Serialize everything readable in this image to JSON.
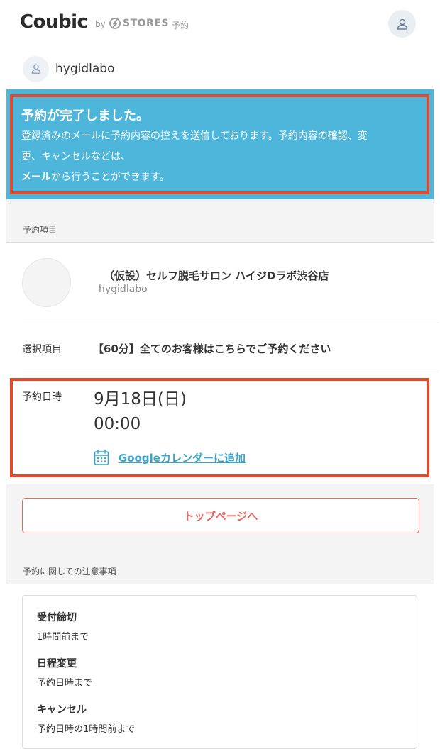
{
  "header": {
    "logo": "Coubic",
    "by": "by",
    "stores": "STORES",
    "stores_sub": "予約"
  },
  "shop": {
    "name": "hygidlabo"
  },
  "banner": {
    "title": "予約が完了しました。",
    "line1": "登録済みのメールに予約内容の控えを送信しております。予約内容の確認、変",
    "line2": "更、キャンセルなどは、",
    "line3_bold": "メール",
    "line3_rest": "から行うことができます。",
    "bg_color": "#4fb6db",
    "highlight_color": "#e24a2b"
  },
  "reservation": {
    "section_label": "予約項目",
    "item_title": "（仮設）セルフ脱毛サロン ハイジDラボ渋谷店",
    "item_sub": "hygidlabo",
    "selection_label": "選択項目",
    "selection_value": "【60分】全てのお客様はこちらでご予約ください",
    "datetime_label": "予約日時",
    "date": "9月18日(日)",
    "time": "00:00",
    "gcal_link": "Googleカレンダーに追加"
  },
  "top_button": {
    "label": "トップページへ"
  },
  "notes": {
    "section_label": "予約に関しての注意事項",
    "items": [
      {
        "title": "受付締切",
        "body": "1時間前まで"
      },
      {
        "title": "日程変更",
        "body": "予約日時まで"
      },
      {
        "title": "キャンセル",
        "body": "予約日時の1時間前まで"
      }
    ]
  }
}
